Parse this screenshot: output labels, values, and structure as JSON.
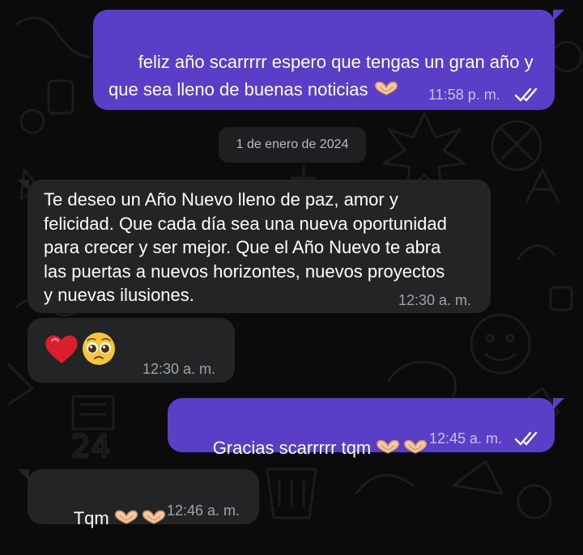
{
  "conversation": {
    "messages": [
      {
        "id": "m1",
        "direction": "outgoing",
        "text": "feliz año scarrrrr espero que tengas un gran año y\nque sea lleno de buenas noticias",
        "trailing_emoji": "heart-hands",
        "time": "11:58 p. m.",
        "read_status": "read"
      },
      {
        "id": "m2",
        "direction": "incoming",
        "text": "Te deseo un Año Nuevo lleno de paz, amor y\nfelicidad. Que cada día sea una nueva oportunidad\npara crecer y ser mejor. Que el Año Nuevo te abra\nlas puertas a nuevos horizontes, nuevos proyectos\ny nuevas ilusiones.",
        "time": "12:30 a. m."
      },
      {
        "id": "m3",
        "direction": "incoming",
        "emojis": [
          "red-heart",
          "pleading-face"
        ],
        "time": "12:30 a. m."
      },
      {
        "id": "m4",
        "direction": "outgoing",
        "text": "Gracias scarrrrr tqm",
        "trailing_emoji": "heart-hands-x2",
        "time": "12:45 a. m.",
        "read_status": "read"
      },
      {
        "id": "m5",
        "direction": "incoming",
        "text": "Tqm",
        "trailing_emoji": "heart-hands-x2",
        "time": "12:46 a. m."
      }
    ],
    "date_separator": "1 de enero de 2024"
  },
  "colors": {
    "outgoing_bubble": "#5a3ec8",
    "incoming_bubble": "#222426",
    "background": "#0b0b0b",
    "read_ticks": "#ffffff"
  },
  "icons": {
    "read_receipt": "double-check-icon",
    "heart_hands": "heart-hands-icon",
    "red_heart": "red-heart-icon",
    "pleading_face": "pleading-face-icon"
  }
}
